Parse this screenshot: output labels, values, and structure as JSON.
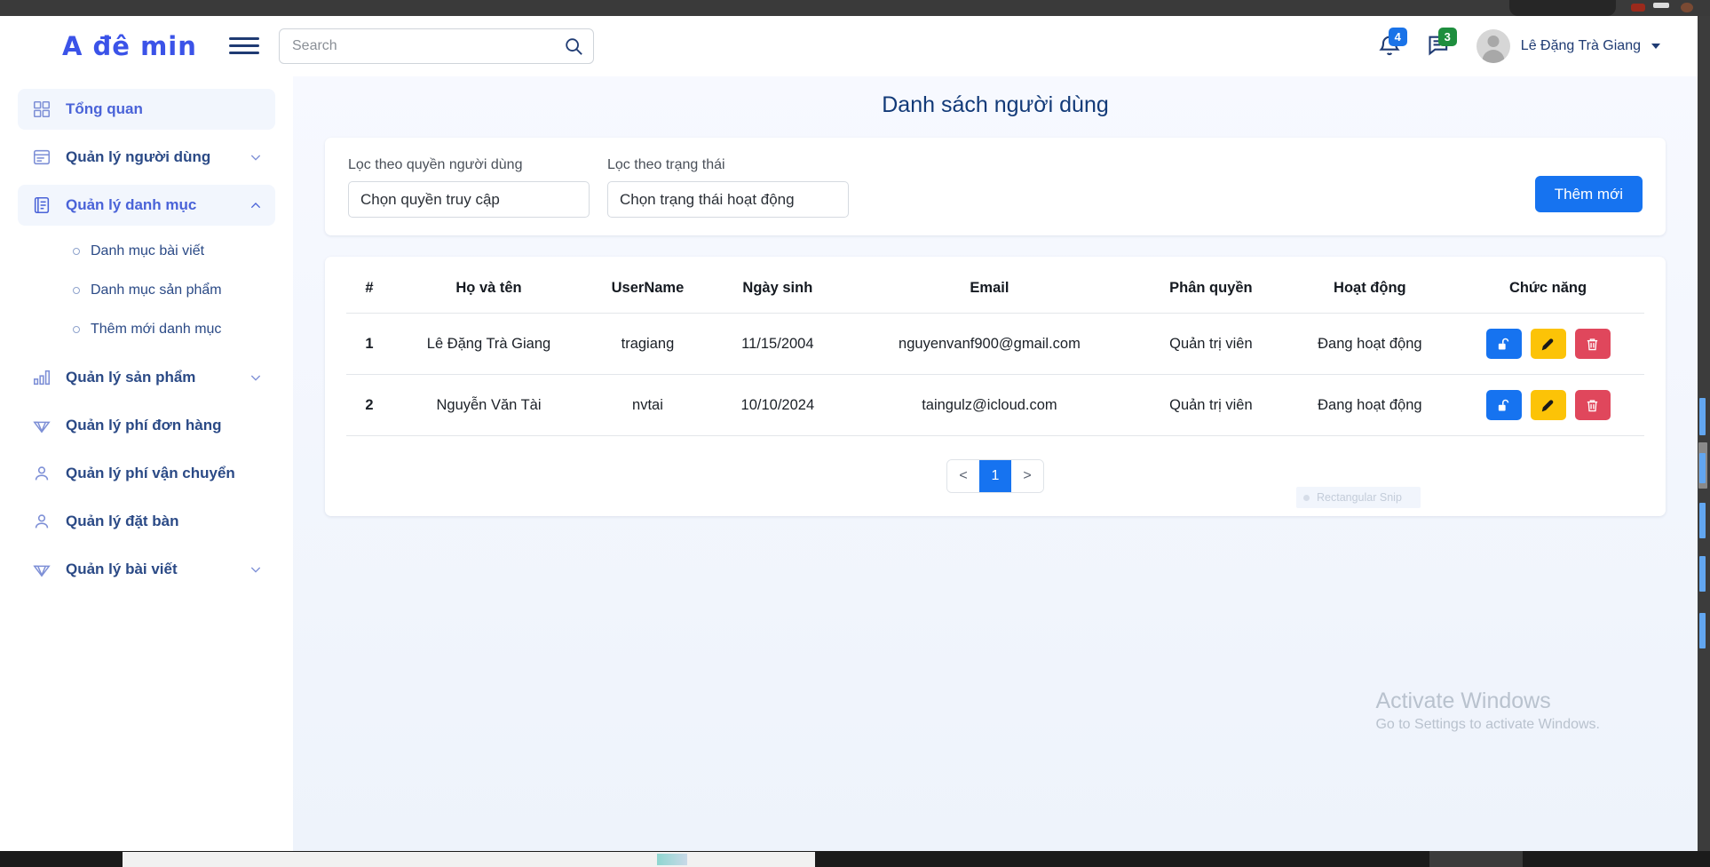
{
  "header": {
    "brand": "A đê min",
    "menu_icon": "hamburger-icon",
    "search": {
      "value": "",
      "placeholder": "Search",
      "icon": "search-icon"
    },
    "notifications": {
      "icon": "bell-icon",
      "count": "4",
      "color": "#1a73e8"
    },
    "messages": {
      "icon": "chat-icon",
      "count": "3",
      "color": "#1e8e3e"
    },
    "user": {
      "name": "Lê Đặng Trà Giang",
      "avatar": "avatar-placeholder-icon",
      "caret": "caret-down-icon"
    }
  },
  "sidebar": {
    "items": [
      {
        "label": "Tổng quan",
        "icon": "dashboard-grid-icon",
        "active": true,
        "expandable": false
      },
      {
        "label": "Quản lý người dùng",
        "icon": "users-list-icon",
        "active": false,
        "expandable": true,
        "expanded": false
      },
      {
        "label": "Quản lý danh mục",
        "icon": "category-list-icon",
        "active": true,
        "expandable": true,
        "expanded": true
      },
      {
        "label": "Quản lý sản phẩm",
        "icon": "bar-chart-icon",
        "active": false,
        "expandable": true,
        "expanded": false
      },
      {
        "label": "Quản lý phí đơn hàng",
        "icon": "diamond-icon",
        "active": false,
        "expandable": false
      },
      {
        "label": "Quản lý phí vận chuyển",
        "icon": "person-icon",
        "active": false,
        "expandable": false
      },
      {
        "label": "Quản lý đặt bàn",
        "icon": "person-icon",
        "active": false,
        "expandable": false
      },
      {
        "label": "Quản lý bài viết",
        "icon": "diamond-icon",
        "active": false,
        "expandable": true,
        "expanded": false
      }
    ],
    "sub_items": [
      {
        "label": "Danh mục bài viết"
      },
      {
        "label": "Danh mục sản phẩm"
      },
      {
        "label": "Thêm mới danh mục"
      }
    ]
  },
  "main": {
    "page_title": "Danh sách người dùng",
    "filters": {
      "role": {
        "label": "Lọc theo quyền người dùng",
        "value": "Chọn quyền truy cập"
      },
      "status": {
        "label": "Lọc theo trạng thái",
        "value": "Chọn trạng thái hoạt động"
      }
    },
    "add_button": "Thêm mới",
    "table": {
      "headers": [
        "#",
        "Họ và tên",
        "UserName",
        "Ngày sinh",
        "Email",
        "Phân quyền",
        "Hoạt động",
        "Chức năng"
      ],
      "rows": [
        {
          "index": "1",
          "name": "Lê Đặng Trà Giang",
          "username": "tragiang",
          "dob": "11/15/2004",
          "email": "nguyenvanf900@gmail.com",
          "role": "Quản trị viên",
          "status": "Đang hoạt động"
        },
        {
          "index": "2",
          "name": "Nguyễn Văn Tài",
          "username": "nvtai",
          "dob": "10/10/2024",
          "email": "taingulz@icloud.com",
          "role": "Quản trị viên",
          "status": "Đang hoạt động"
        }
      ],
      "row_actions": [
        {
          "icon": "unlock-icon",
          "color": "#1673f0"
        },
        {
          "icon": "pencil-edit-icon",
          "color": "#fcc307"
        },
        {
          "icon": "trash-delete-icon",
          "color": "#e0475c"
        }
      ]
    },
    "pagination": {
      "prev": "<",
      "pages": [
        "1"
      ],
      "next": ">",
      "active": "1"
    }
  },
  "overlay": {
    "watermark_title": "Activate Windows",
    "watermark_sub": "Go to Settings to activate Windows.",
    "snip_tooltip": "Rectangular Snip"
  },
  "colors": {
    "brand": "#3b53e8",
    "primary": "#1673f0",
    "sidebar_text": "#2b4a86",
    "sidebar_active": "#4a63d8",
    "title": "#123a78"
  }
}
